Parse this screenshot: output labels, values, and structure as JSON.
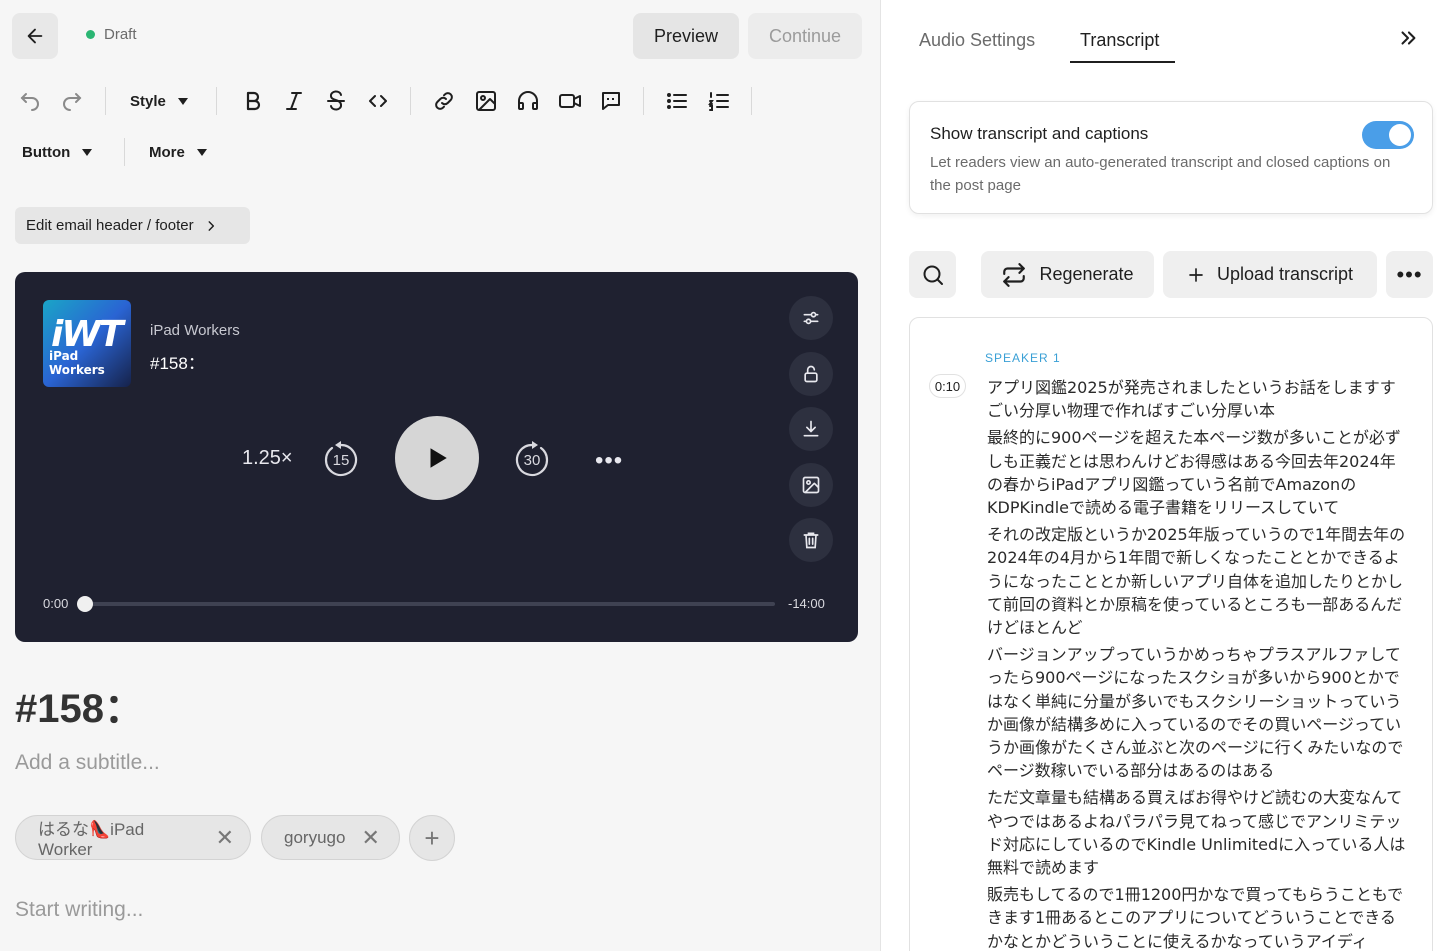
{
  "header": {
    "status": "Draft",
    "preview_label": "Preview",
    "continue_label": "Continue"
  },
  "toolbar": {
    "style_label": "Style",
    "button_label": "Button",
    "more_label": "More",
    "icons": [
      "undo-icon",
      "redo-icon",
      "bold-icon",
      "italic-icon",
      "strikethrough-icon",
      "code-icon",
      "link-icon",
      "image-icon",
      "headphones-icon",
      "video-icon",
      "quote-icon",
      "bullet-list-icon",
      "numbered-list-icon"
    ]
  },
  "email_header_label": "Edit email header / footer",
  "player": {
    "podcast_name": "iPad Workers",
    "episode_title": "#158：",
    "cover_logo": "iWT",
    "cover_text": "iPad Workers",
    "speed": "1.25×",
    "skip_back": "15",
    "skip_forward": "30",
    "time_current": "0:00",
    "time_remaining": "-14:00",
    "progress": 0
  },
  "post": {
    "title": "#158：",
    "subtitle_placeholder": "Add a subtitle...",
    "authors": [
      "はるな👠iPad Worker",
      "goryugo"
    ],
    "body_placeholder": "Start writing..."
  },
  "panel": {
    "tabs": [
      "Audio Settings",
      "Transcript"
    ],
    "active_tab": "Transcript",
    "transcript_toggle": {
      "title": "Show transcript and captions",
      "description": "Let readers view an auto-generated transcript and closed captions on the post page",
      "enabled": true,
      "accent": "#4a9ee8"
    },
    "regenerate_label": "Regenerate",
    "upload_label": "Upload transcript",
    "transcript": {
      "speaker": "SPEAKER 1",
      "timestamp": "0:10",
      "paragraphs": [
        "アプリ図鑑2025が発売されましたというお話をしますすごい分厚い物理で作ればすごい分厚い本",
        "最終的に900ページを超えた本ページ数が多いことが必ずしも正義だとは思わんけどお得感はある今回去年2024年の春からiPadアプリ図鑑っていう名前でAmazonのKDPKindleで読める電子書籍をリリースしていて",
        "それの改定版というか2025年版っていうので1年間去年の2024年の4月から1年間で新しくなったこととかできるようになったこととか新しいアプリ自体を追加したりとかして前回の資料とか原稿を使っているところも一部あるんだけどほとんど",
        "バージョンアップっていうかめっちゃプラスアルファしてったら900ページになったスクショが多いから900とかではなく単純に分量が多いでもスクシリーショットっていうか画像が結構多めに入っているのでその買いページっていうか画像がたくさん並ぶと次のページに行くみたいなのでページ数稼いでいる部分はあるのはある",
        "ただ文章量も結構ある買えばお得やけど読むの大変なんてやつではあるよねパラパラ見てねって感じでアンリミテッド対応にしているのでKindle Unlimitedに入っている人は無料で読めます",
        "販売もしてるので1冊1200円かなで買ってもらうこともできます1冊あるとこのアプリについてどういうことできるかなとかどういうことに使えるかなっていうアイディ"
      ]
    }
  }
}
